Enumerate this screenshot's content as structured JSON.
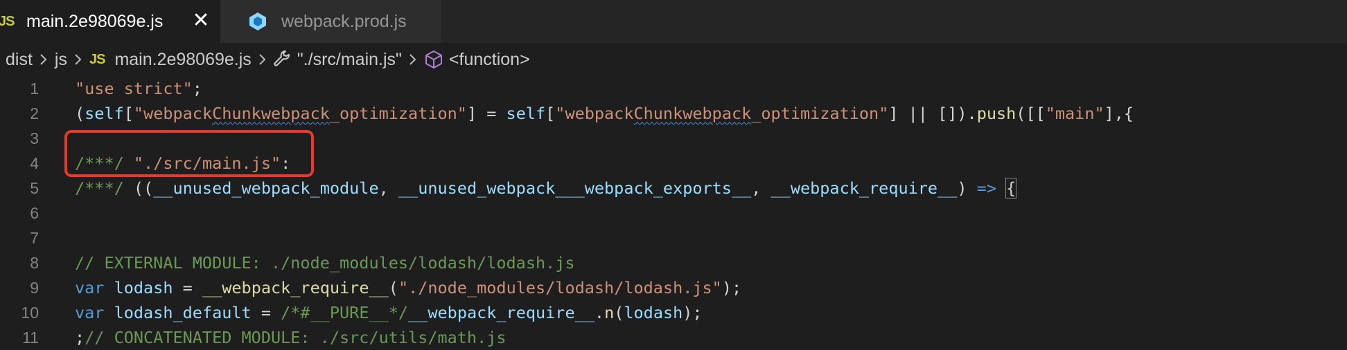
{
  "tabs": [
    {
      "badge": "JS",
      "label": "main.2e98069e.js",
      "active": true,
      "close": "✕"
    },
    {
      "label": "webpack.prod.js",
      "active": false,
      "icon": "webpack-icon"
    }
  ],
  "breadcrumb": {
    "items": [
      "dist",
      "js"
    ],
    "file_badge": "JS",
    "file": "main.2e98069e.js",
    "symbol": "\"./src/main.js\"",
    "function": "<function>"
  },
  "colors": {
    "editor_bg": "#1e1e1e",
    "string": "#ce9178",
    "variable": "#9cdcfe",
    "function": "#dcdcaa",
    "keyword": "#569cd6",
    "comment": "#6a9955",
    "highlight": "#e8392b"
  },
  "lines": [
    {
      "n": "1",
      "tokens": [
        {
          "t": "\"use strict\"",
          "c": "t-str"
        },
        {
          "t": ";",
          "c": "t-plain"
        }
      ]
    },
    {
      "n": "2",
      "tokens": [
        {
          "t": "(",
          "c": "t-plain"
        },
        {
          "t": "self",
          "c": "t-var"
        },
        {
          "t": "[",
          "c": "t-plain"
        },
        {
          "t": "\"webpack",
          "c": "t-str"
        },
        {
          "t": "Chunkwebpack",
          "c": "t-str squiggle"
        },
        {
          "t": "_optimization\"",
          "c": "t-str"
        },
        {
          "t": "] = ",
          "c": "t-plain"
        },
        {
          "t": "self",
          "c": "t-var"
        },
        {
          "t": "[",
          "c": "t-plain"
        },
        {
          "t": "\"webpack",
          "c": "t-str"
        },
        {
          "t": "Chunkwebpack",
          "c": "t-str squiggle"
        },
        {
          "t": "_optimization\"",
          "c": "t-str"
        },
        {
          "t": "] || []).",
          "c": "t-plain"
        },
        {
          "t": "push",
          "c": "t-fn"
        },
        {
          "t": "([[",
          "c": "t-plain"
        },
        {
          "t": "\"main\"",
          "c": "t-str"
        },
        {
          "t": "],{",
          "c": "t-plain"
        }
      ]
    },
    {
      "n": "3",
      "tokens": []
    },
    {
      "n": "4",
      "tokens": [
        {
          "t": "/***/ ",
          "c": "t-com"
        },
        {
          "t": "\"./src/main.js\"",
          "c": "t-str"
        },
        {
          "t": ":",
          "c": "t-plain"
        }
      ]
    },
    {
      "n": "5",
      "tokens": [
        {
          "t": "/***/ ",
          "c": "t-com"
        },
        {
          "t": "((",
          "c": "t-plain"
        },
        {
          "t": "__unused_webpack_module",
          "c": "t-var"
        },
        {
          "t": ", ",
          "c": "t-plain"
        },
        {
          "t": "__unused_webpack___webpack_exports__",
          "c": "t-var"
        },
        {
          "t": ", ",
          "c": "t-plain"
        },
        {
          "t": "__webpack_require__",
          "c": "t-var"
        },
        {
          "t": ") ",
          "c": "t-plain"
        },
        {
          "t": "=>",
          "c": "t-kw"
        },
        {
          "t": " ",
          "c": "t-plain"
        },
        {
          "t": "{",
          "c": "t-plain bracket-box"
        }
      ]
    },
    {
      "n": "6",
      "tokens": []
    },
    {
      "n": "7",
      "tokens": []
    },
    {
      "n": "8",
      "tokens": [
        {
          "t": "// EXTERNAL MODULE: ./node_modules/lodash/lodash.js",
          "c": "t-com"
        }
      ]
    },
    {
      "n": "9",
      "tokens": [
        {
          "t": "var",
          "c": "t-kw"
        },
        {
          "t": " ",
          "c": "t-plain"
        },
        {
          "t": "lodash",
          "c": "t-var"
        },
        {
          "t": " = ",
          "c": "t-plain"
        },
        {
          "t": "__webpack_require__",
          "c": "t-fn"
        },
        {
          "t": "(",
          "c": "t-plain"
        },
        {
          "t": "\"./node_modules/lodash/lodash.js\"",
          "c": "t-str"
        },
        {
          "t": ");",
          "c": "t-plain"
        }
      ]
    },
    {
      "n": "10",
      "tokens": [
        {
          "t": "var",
          "c": "t-kw"
        },
        {
          "t": " ",
          "c": "t-plain"
        },
        {
          "t": "lodash_default",
          "c": "t-var"
        },
        {
          "t": " = ",
          "c": "t-plain"
        },
        {
          "t": "/*#__PURE__*/",
          "c": "t-com"
        },
        {
          "t": "__webpack_require__",
          "c": "t-var"
        },
        {
          "t": ".",
          "c": "t-plain"
        },
        {
          "t": "n",
          "c": "t-fn"
        },
        {
          "t": "(",
          "c": "t-plain"
        },
        {
          "t": "lodash",
          "c": "t-var"
        },
        {
          "t": ");",
          "c": "t-plain"
        }
      ]
    },
    {
      "n": "11",
      "tokens": [
        {
          "t": ";",
          "c": "t-plain"
        },
        {
          "t": "// CONCATENATED MODULE: ./src/utils/math.js",
          "c": "t-com"
        }
      ]
    }
  ]
}
